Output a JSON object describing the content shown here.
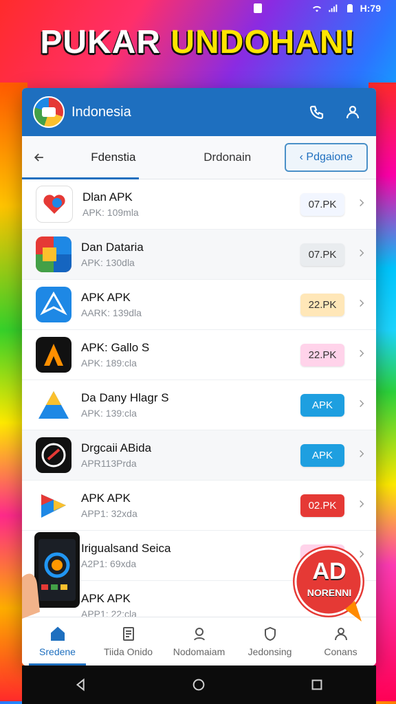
{
  "status_bar": {
    "time": "H:79"
  },
  "headline": {
    "word1": "PUKAR",
    "word2": "UNDOHAN!"
  },
  "app_bar": {
    "title": "Indonesia"
  },
  "tabs": {
    "items": [
      {
        "label": "Fdenstia"
      },
      {
        "label": "Drdonain"
      }
    ],
    "button_label": "‹ Pdgaione"
  },
  "apps": [
    {
      "title": "Dlan APK",
      "subtitle": "APK: 109mla",
      "badge": "07.PK",
      "badge_color": "#f2f6ff",
      "badge_text_color": "#333"
    },
    {
      "title": "Dan Dataria",
      "subtitle": "APK: 130dla",
      "badge": "07.PK",
      "badge_color": "#e9ecef",
      "badge_text_color": "#333"
    },
    {
      "title": "APK APK",
      "subtitle": "AARK: 139dla",
      "badge": "22.PK",
      "badge_color": "#ffe7b8",
      "badge_text_color": "#333"
    },
    {
      "title": "APK: Gallo S",
      "subtitle": "APK: 189:cla",
      "badge": "22.PK",
      "badge_color": "#ffd3ea",
      "badge_text_color": "#333"
    },
    {
      "title": "Da Dany Hlagr S",
      "subtitle": "APK: 139:cla",
      "badge": "APK",
      "badge_color": "#1e9fe0",
      "badge_text_color": "#fff"
    },
    {
      "title": "Drgcaii ABida",
      "subtitle": "APR113Prda",
      "badge": "APK",
      "badge_color": "#1e9fe0",
      "badge_text_color": "#fff"
    },
    {
      "title": "APK APK",
      "subtitle": "APP1: 32xda",
      "badge": "02.PK",
      "badge_color": "#e53935",
      "badge_text_color": "#fff"
    },
    {
      "title": "Irigualsand Seica",
      "subtitle": "A2P1: 69xda",
      "badge": "07.PK",
      "badge_color": "#ffd3ea",
      "badge_text_color": "#333"
    },
    {
      "title": "APK APK",
      "subtitle": "APP1: 22:cla",
      "badge": "",
      "badge_color": "#ffffff",
      "badge_text_color": "#333"
    }
  ],
  "bottom_nav": [
    {
      "label": "Sredene"
    },
    {
      "label": "Tiida Onido"
    },
    {
      "label": "Nodomaiam"
    },
    {
      "label": "Jedonsing"
    },
    {
      "label": "Conans"
    }
  ],
  "ad_sticker": {
    "line1": "AD",
    "line2": "NORENNI"
  },
  "icons": {
    "status": [
      "alert-icon",
      "wifi-icon",
      "signal-icon",
      "battery-icon"
    ],
    "app_bar": [
      "phone-icon",
      "user-icon"
    ],
    "android_nav": [
      "back-triangle-icon",
      "home-circle-icon",
      "recents-square-icon"
    ]
  }
}
